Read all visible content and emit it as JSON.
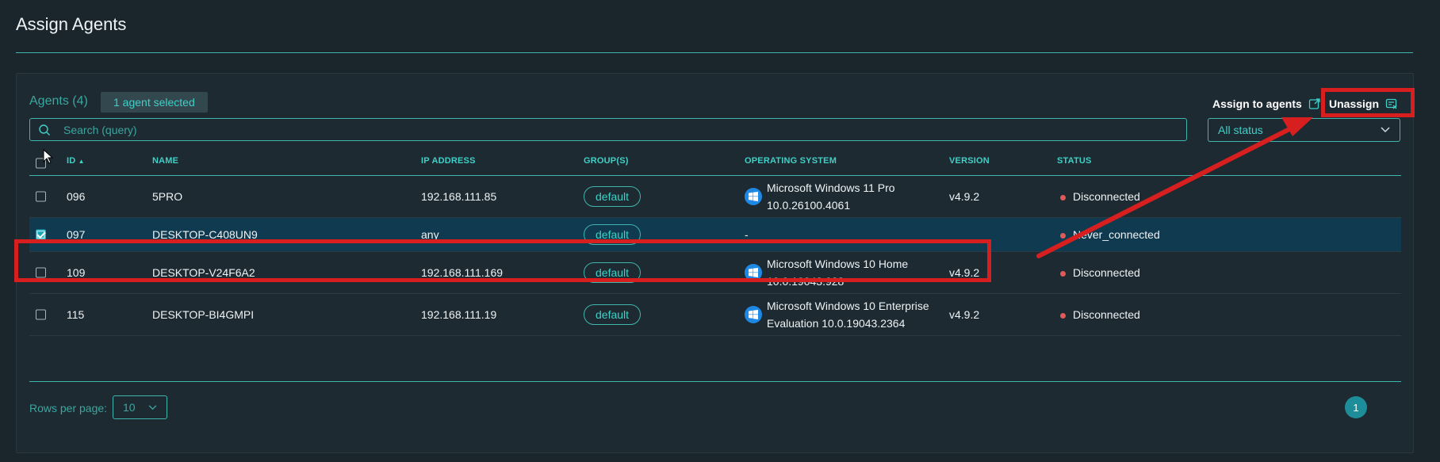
{
  "page": {
    "title": "Assign Agents"
  },
  "toolbar": {
    "agents_count": "Agents (4)",
    "selected_badge": "1 agent selected",
    "assign_label": "Assign to agents",
    "unassign_label": "Unassign"
  },
  "search": {
    "placeholder": "Search (query)",
    "value": ""
  },
  "status_filter": {
    "selected": "All status"
  },
  "table": {
    "columns": [
      "ID",
      "NAME",
      "IP ADDRESS",
      "GROUP(S)",
      "OPERATING SYSTEM",
      "VERSION",
      "STATUS"
    ],
    "sort": {
      "column": "ID",
      "direction": "ascending"
    },
    "rows": [
      {
        "id": "096",
        "name": "5PRO",
        "ip": "192.168.111.85",
        "group": "default",
        "os_line1": "Microsoft Windows 11 Pro",
        "os_line2": "10.0.26100.4061",
        "version": "v4.9.2",
        "status": "Disconnected",
        "checked": false,
        "os_icon": "windows-icon"
      },
      {
        "id": "097",
        "name": "DESKTOP-C408UN9",
        "ip": "any",
        "group": "default",
        "os_line1": "-",
        "os_line2": "",
        "version": "",
        "status": "Never_connected",
        "checked": true,
        "os_icon": ""
      },
      {
        "id": "109",
        "name": "DESKTOP-V24F6A2",
        "ip": "192.168.111.169",
        "group": "default",
        "os_line1": "Microsoft Windows 10 Home",
        "os_line2": "10.0.19043.928",
        "version": "v4.9.2",
        "status": "Disconnected",
        "checked": false,
        "os_icon": "windows-icon"
      },
      {
        "id": "115",
        "name": "DESKTOP-BI4GMPI",
        "ip": "192.168.111.19",
        "group": "default",
        "os_line1": "Microsoft Windows 10 Enterprise",
        "os_line2": "Evaluation 10.0.19043.2364",
        "version": "v4.9.2",
        "status": "Disconnected",
        "checked": false,
        "os_icon": "windows-icon"
      }
    ]
  },
  "pagination": {
    "rows_per_page_label": "Rows per page:",
    "rows_per_page": "10",
    "current_page": "1"
  },
  "colors": {
    "accent": "#3fd0c8",
    "selected_row": "#0f3a4f",
    "status_red": "#e05a5a",
    "annotation_red": "#d81f1f"
  }
}
